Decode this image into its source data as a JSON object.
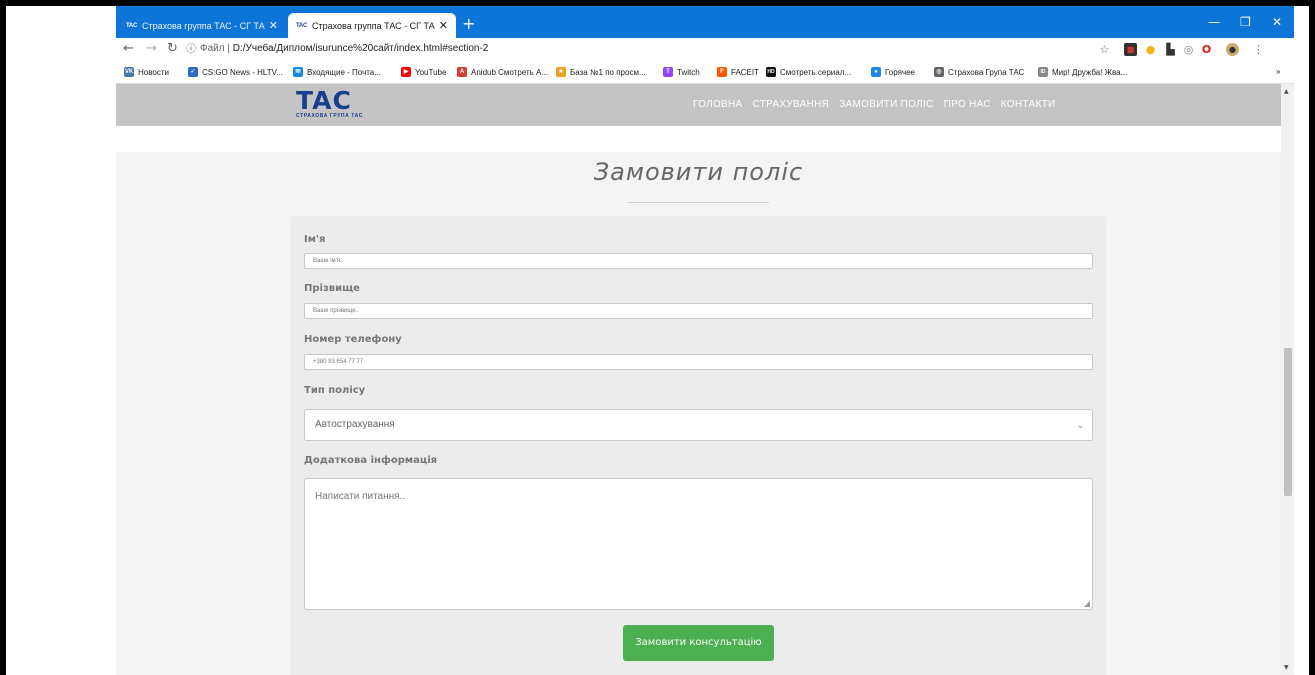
{
  "browser": {
    "tabs": [
      {
        "favicon": "TAC",
        "title": "Страхова группа ТАС - СГ ТАС",
        "active": false
      },
      {
        "favicon": "TAC",
        "title": "Страхова группа ТАС - СГ ТАС",
        "active": true
      }
    ],
    "new_tab": "+",
    "window_controls": {
      "minimize": "—",
      "restore": "❐",
      "close": "✕"
    },
    "address": {
      "prefix": "Файл",
      "url": "D:/Учеба/Диплом/isurunce%20сайт/index.html#section-2"
    },
    "bookmarks": [
      {
        "label": "Новости",
        "color": "#4a76a8",
        "glyph": "VK"
      },
      {
        "label": "CS:GO News - HLTV...",
        "color": "#2d6cc0",
        "glyph": "✓"
      },
      {
        "label": "Входящие - Почта...",
        "color": "#168de2",
        "glyph": "✉"
      },
      {
        "label": "YouTube",
        "color": "#ff0000",
        "glyph": "▶"
      },
      {
        "label": "Anidub Смотреть А...",
        "color": "#d23f31",
        "glyph": "A"
      },
      {
        "label": "База №1 по просм...",
        "color": "#f0a020",
        "glyph": "★"
      },
      {
        "label": "Twitch",
        "color": "#9146ff",
        "glyph": "T"
      },
      {
        "label": "FACEIT",
        "color": "#ff5500",
        "glyph": "F"
      },
      {
        "label": "Смотреть сериал...",
        "color": "#111111",
        "glyph": "HD"
      },
      {
        "label": "Горячее",
        "color": "#1e88e5",
        "glyph": "●"
      },
      {
        "label": "Страхова Група ТАС",
        "color": "#5f6368",
        "glyph": "◎"
      },
      {
        "label": "Мир! Дружба! Жва...",
        "color": "#888888",
        "glyph": "ID"
      }
    ],
    "bookmarks_more": "»"
  },
  "site": {
    "logo_text": "TAC",
    "logo_sub": "СТРАХОВА ГРУПА ТАС",
    "brand_color": "#1b3f8f",
    "menu": [
      "ГОЛОВНА",
      "СТРАХУВАННЯ",
      "ЗАМОВИТИ ПОЛІС",
      "ПРО НАС",
      "КОНТАКТИ"
    ]
  },
  "section": {
    "title": "Замовити поліс"
  },
  "form": {
    "first_name": {
      "label": "Ім'я",
      "placeholder": "Ваше ім'я.."
    },
    "last_name": {
      "label": "Прізвище",
      "placeholder": "Ваше прізвище.."
    },
    "phone": {
      "label": "Номер телефону",
      "placeholder": "+380 93 654 77 77"
    },
    "policy_type": {
      "label": "Тип полісу",
      "selected": "Автострахування"
    },
    "additional": {
      "label": "Додаткова інформація",
      "placeholder": "Написати питання.."
    },
    "submit_label": "Замовити консультацію",
    "submit_color": "#4caf50"
  }
}
